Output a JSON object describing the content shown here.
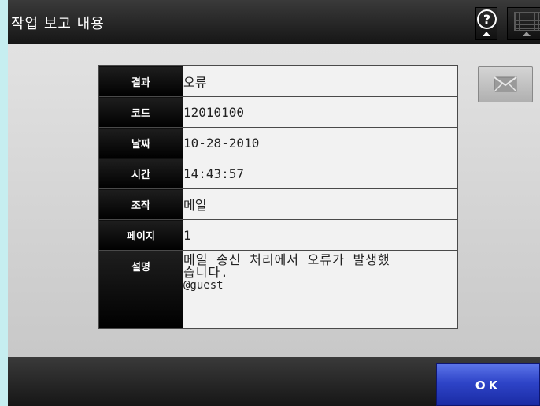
{
  "window": {
    "title": "작업 보고 내용"
  },
  "toolbar": {
    "help_symbol": "?",
    "help_icon": "help-circle-icon",
    "keyboard_icon": "keyboard-icon"
  },
  "report": {
    "rows": [
      {
        "label": "결과",
        "value": "오류"
      },
      {
        "label": "코드",
        "value": "12010100"
      },
      {
        "label": "날짜",
        "value": "10-28-2010"
      },
      {
        "label": "시간",
        "value": "14:43:57"
      },
      {
        "label": "조작",
        "value": "메일"
      },
      {
        "label": "페이지",
        "value": "1"
      }
    ],
    "description": {
      "label": "설명",
      "line1": "메일 송신 처리에서 오류가 발생했",
      "line2": "습니다.",
      "line3": "@guest"
    }
  },
  "actions": {
    "mail_icon": "envelope-icon",
    "ok_label": "OK"
  },
  "colors": {
    "ok_button": "#2e44c8",
    "background": "#c6eef0",
    "title_bar": "#1e1e1e"
  }
}
